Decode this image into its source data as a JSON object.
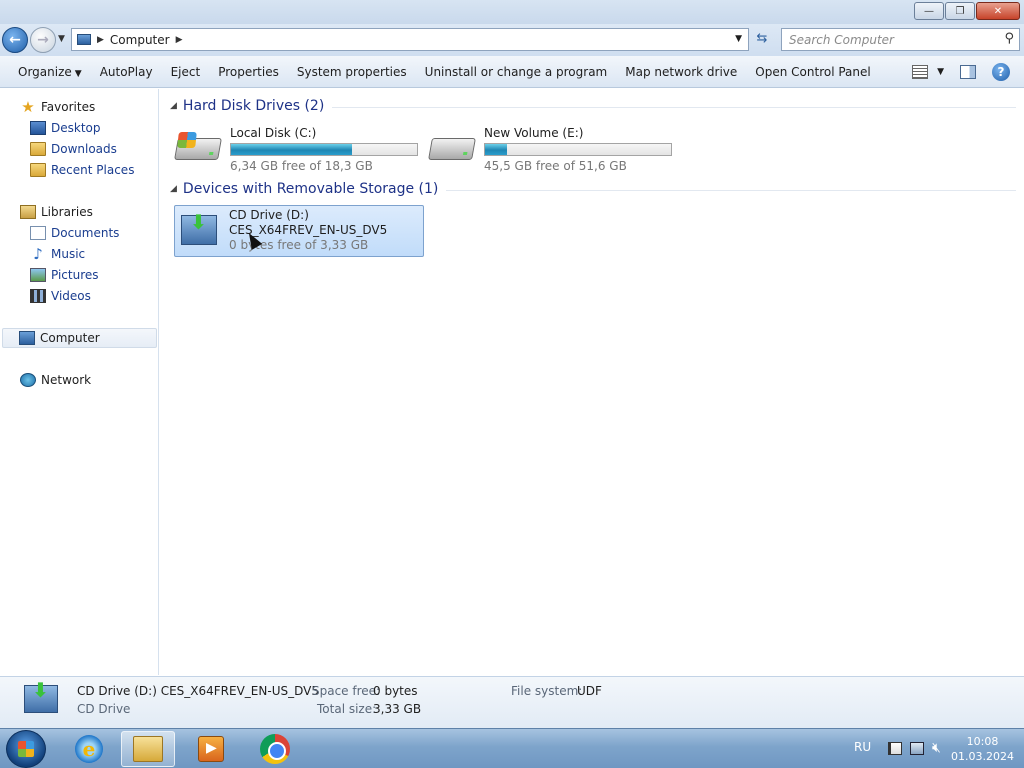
{
  "window": {
    "minimize_glyph": "—",
    "restore_glyph": "❐",
    "close_glyph": "✕"
  },
  "address": {
    "breadcrumb": "Computer",
    "search_placeholder": "Search Computer"
  },
  "toolbar": {
    "organize": "Organize",
    "autoplay": "AutoPlay",
    "eject": "Eject",
    "properties": "Properties",
    "system_properties": "System properties",
    "uninstall": "Uninstall or change a program",
    "map_drive": "Map network drive",
    "control_panel": "Open Control Panel",
    "help_glyph": "?"
  },
  "nav": {
    "favorites": "Favorites",
    "desktop": "Desktop",
    "downloads": "Downloads",
    "recent_places": "Recent Places",
    "libraries": "Libraries",
    "documents": "Documents",
    "music": "Music",
    "pictures": "Pictures",
    "videos": "Videos",
    "computer": "Computer",
    "network": "Network"
  },
  "groups": {
    "hdd_title": "Hard Disk Drives (2)",
    "removable_title": "Devices with Removable Storage (1)"
  },
  "drives": {
    "c": {
      "name": "Local Disk (C:)",
      "free_text": "6,34 GB free of 18,3 GB",
      "used_fraction": 0.65
    },
    "e": {
      "name": "New Volume (E:)",
      "free_text": "45,5 GB free of 51,6 GB",
      "used_fraction": 0.12
    },
    "d": {
      "name": "CD Drive (D:)",
      "label": "CES_X64FREV_EN-US_DV5",
      "free_text": "0 bytes free of 3,33 GB"
    }
  },
  "details": {
    "title": "CD Drive (D:) CES_X64FREV_EN-US_DV5",
    "type": "CD Drive",
    "space_free_label": "Space free:",
    "space_free_value": "0 bytes",
    "total_size_label": "Total size:",
    "total_size_value": "3,33 GB",
    "filesystem_label": "File system:",
    "filesystem_value": "UDF"
  },
  "taskbar": {
    "language": "RU",
    "time": "10:08",
    "date": "01.03.2024",
    "ie_glyph": "e"
  },
  "colors": {
    "group_title": "#1e3287",
    "nav_link": "#1a3d8f",
    "selection": "#c1dcfa",
    "bar_fill": "#1f86b3"
  }
}
